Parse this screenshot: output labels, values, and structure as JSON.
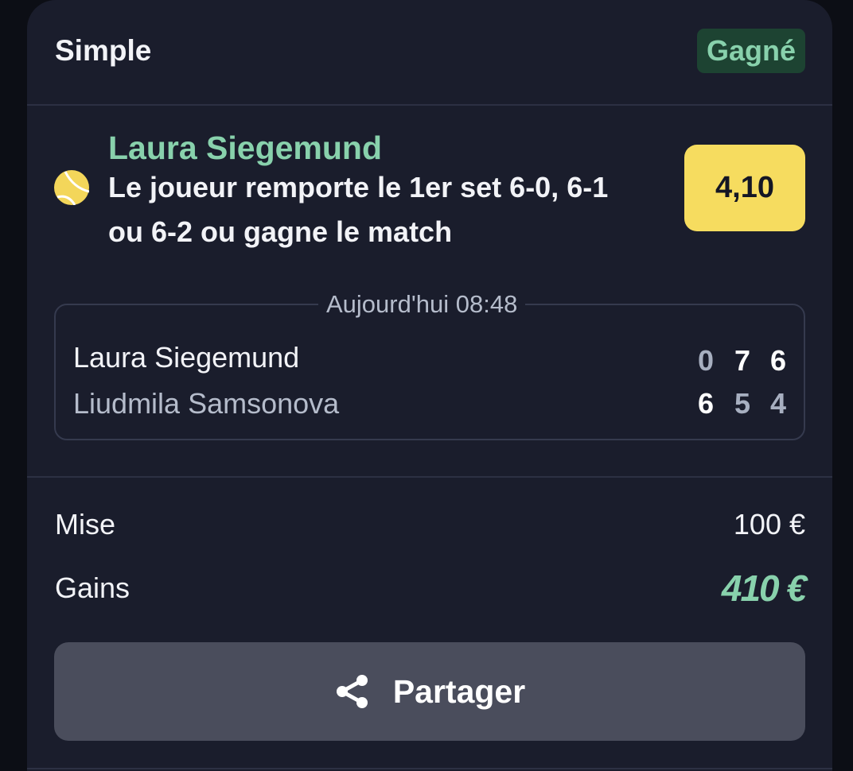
{
  "bet": {
    "type": "Simple",
    "status": "Gagné"
  },
  "selection": {
    "player": "Laura Siegemund",
    "market_line1": "Le joueur remporte le 1er set 6-0, 6-1",
    "market_line2": "ou 6-2 ou gagne le match",
    "odds": "4,10",
    "sport_icon": "tennis-ball-icon"
  },
  "match": {
    "time": "Aujourd'hui 08:48",
    "home": {
      "name": "Laura Siegemund",
      "sets": [
        "0",
        "7",
        "6"
      ]
    },
    "away": {
      "name": "Liudmila Samsonova",
      "sets": [
        "6",
        "5",
        "4"
      ]
    }
  },
  "summary": {
    "stake_label": "Mise",
    "stake_value": "100 €",
    "payout_label": "Gains",
    "payout_value": "410 €"
  },
  "share": {
    "label": "Partager",
    "icon": "share-icon"
  },
  "colors": {
    "background": "#0c0e15",
    "card": "#1a1d2c",
    "accent_green": "#88d1ac",
    "badge_bg": "#1d4332",
    "odds_yellow": "#f6dc5f",
    "share_button": "#4a4d5c"
  }
}
